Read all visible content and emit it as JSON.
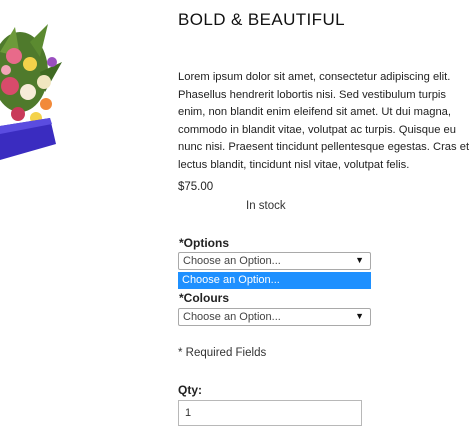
{
  "product": {
    "title": "BOLD & BEAUTIFUL",
    "description": "Lorem ipsum dolor sit amet, consectetur adipiscing elit. Phasellus hendrerit lobortis nisi. Sed vestibulum turpis enim, non blandit enim eleifend sit amet. Ut dui magna, commodo in blandit vitae, volutpat ac turpis. Quisque eu nunc nisi. Praesent tincidunt pellentesque egestas. Cras et lectus blandit, tincidunt nisl vitae, volutpat felis.",
    "price": "$75.00",
    "stock": "In stock"
  },
  "options": {
    "required_mark": "*",
    "label": "Options",
    "value": "Choose an Option...",
    "highlighted_option": "Choose an Option..."
  },
  "colours": {
    "required_mark": "*",
    "label": "Colours",
    "value": "Choose an Option..."
  },
  "required_note": "* Required Fields",
  "qty": {
    "label": "Qty:",
    "value": "1"
  },
  "icons": {
    "select_arrow": "▼"
  },
  "colors": {
    "highlight": "#1e90ff"
  }
}
